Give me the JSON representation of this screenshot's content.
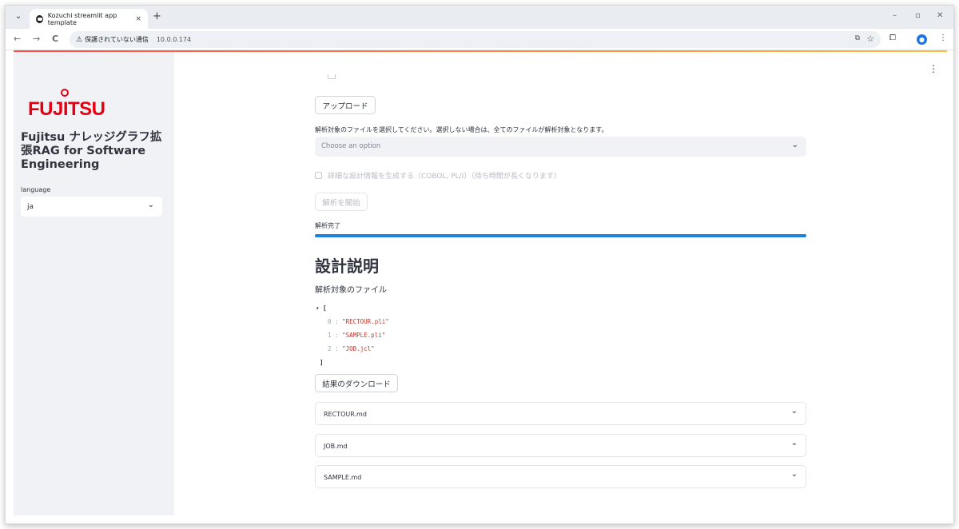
{
  "browser": {
    "tab_title": "Kozuchi streamlit app template",
    "tab_close": "×",
    "new_tab": "+",
    "security_text": "保護されていない通信",
    "url": "10.0.0.174",
    "nav_back": "←",
    "nav_forward": "→",
    "nav_reload": "C",
    "tab_dropdown": "⌄",
    "min": "–",
    "restore": "▫",
    "close": "✕",
    "star": "☆",
    "menu": "⋮"
  },
  "sidebar": {
    "logo_text": "FUJITSU",
    "app_title": "Fujitsu ナレッジグラフ拡張RAG for Software Engineering",
    "language_label": "language",
    "language_value": "ja"
  },
  "main": {
    "upload_button": "アップロード",
    "file_select_instruction": "解析対象のファイルを選択してください。選択しない場合は、全てのファイルが解析対象となります。",
    "file_select_placeholder": "Choose an option",
    "detail_checkbox_label": "詳細な設計情報を生成する（COBOL, PL/I）（待ち時間が長くなります）",
    "start_button": "解析を開始",
    "status_text": "解析完了",
    "progress": 1.0,
    "heading": "設計説明",
    "files_label": "解析対象のファイル",
    "json_open": "[",
    "json_close": "]",
    "files": [
      {
        "index": "0",
        "value": "\"RECTOUR.pli\""
      },
      {
        "index": "1",
        "value": "\"SAMPLE.pli\""
      },
      {
        "index": "2",
        "value": "\"JOB.jcl\""
      }
    ],
    "download_button": "結果のダウンロード",
    "expanders": [
      "RECTOUR.md",
      "JOB.md",
      "SAMPLE.md"
    ]
  },
  "colors": {
    "accent_start": "#ff4b4b",
    "accent_end": "#ffbd45",
    "progress": "#1c83e1",
    "logo": "#e60012"
  }
}
